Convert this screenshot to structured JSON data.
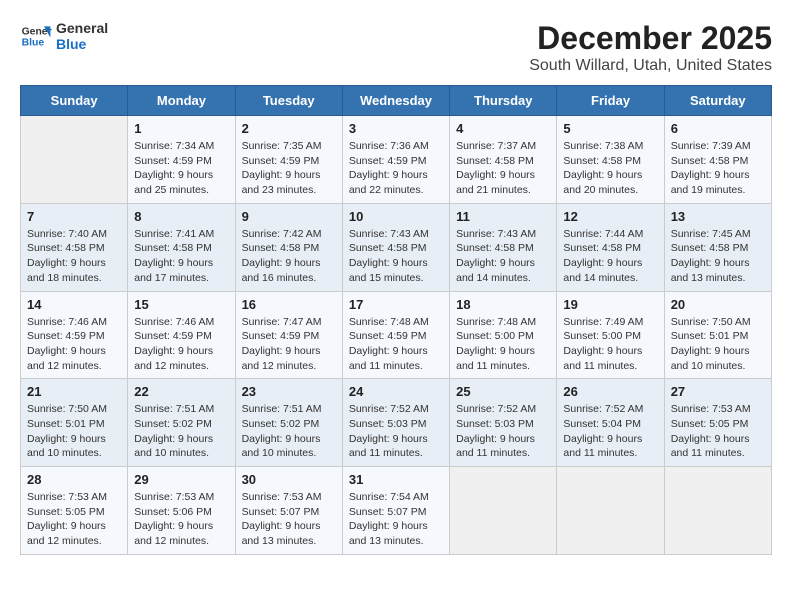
{
  "header": {
    "logo_line1": "General",
    "logo_line2": "Blue",
    "title": "December 2025",
    "subtitle": "South Willard, Utah, United States"
  },
  "calendar": {
    "days_of_week": [
      "Sunday",
      "Monday",
      "Tuesday",
      "Wednesday",
      "Thursday",
      "Friday",
      "Saturday"
    ],
    "weeks": [
      [
        {
          "day": "",
          "info": ""
        },
        {
          "day": "1",
          "info": "Sunrise: 7:34 AM\nSunset: 4:59 PM\nDaylight: 9 hours and 25 minutes."
        },
        {
          "day": "2",
          "info": "Sunrise: 7:35 AM\nSunset: 4:59 PM\nDaylight: 9 hours and 23 minutes."
        },
        {
          "day": "3",
          "info": "Sunrise: 7:36 AM\nSunset: 4:59 PM\nDaylight: 9 hours and 22 minutes."
        },
        {
          "day": "4",
          "info": "Sunrise: 7:37 AM\nSunset: 4:58 PM\nDaylight: 9 hours and 21 minutes."
        },
        {
          "day": "5",
          "info": "Sunrise: 7:38 AM\nSunset: 4:58 PM\nDaylight: 9 hours and 20 minutes."
        },
        {
          "day": "6",
          "info": "Sunrise: 7:39 AM\nSunset: 4:58 PM\nDaylight: 9 hours and 19 minutes."
        }
      ],
      [
        {
          "day": "7",
          "info": "Sunrise: 7:40 AM\nSunset: 4:58 PM\nDaylight: 9 hours and 18 minutes."
        },
        {
          "day": "8",
          "info": "Sunrise: 7:41 AM\nSunset: 4:58 PM\nDaylight: 9 hours and 17 minutes."
        },
        {
          "day": "9",
          "info": "Sunrise: 7:42 AM\nSunset: 4:58 PM\nDaylight: 9 hours and 16 minutes."
        },
        {
          "day": "10",
          "info": "Sunrise: 7:43 AM\nSunset: 4:58 PM\nDaylight: 9 hours and 15 minutes."
        },
        {
          "day": "11",
          "info": "Sunrise: 7:43 AM\nSunset: 4:58 PM\nDaylight: 9 hours and 14 minutes."
        },
        {
          "day": "12",
          "info": "Sunrise: 7:44 AM\nSunset: 4:58 PM\nDaylight: 9 hours and 14 minutes."
        },
        {
          "day": "13",
          "info": "Sunrise: 7:45 AM\nSunset: 4:58 PM\nDaylight: 9 hours and 13 minutes."
        }
      ],
      [
        {
          "day": "14",
          "info": "Sunrise: 7:46 AM\nSunset: 4:59 PM\nDaylight: 9 hours and 12 minutes."
        },
        {
          "day": "15",
          "info": "Sunrise: 7:46 AM\nSunset: 4:59 PM\nDaylight: 9 hours and 12 minutes."
        },
        {
          "day": "16",
          "info": "Sunrise: 7:47 AM\nSunset: 4:59 PM\nDaylight: 9 hours and 12 minutes."
        },
        {
          "day": "17",
          "info": "Sunrise: 7:48 AM\nSunset: 4:59 PM\nDaylight: 9 hours and 11 minutes."
        },
        {
          "day": "18",
          "info": "Sunrise: 7:48 AM\nSunset: 5:00 PM\nDaylight: 9 hours and 11 minutes."
        },
        {
          "day": "19",
          "info": "Sunrise: 7:49 AM\nSunset: 5:00 PM\nDaylight: 9 hours and 11 minutes."
        },
        {
          "day": "20",
          "info": "Sunrise: 7:50 AM\nSunset: 5:01 PM\nDaylight: 9 hours and 10 minutes."
        }
      ],
      [
        {
          "day": "21",
          "info": "Sunrise: 7:50 AM\nSunset: 5:01 PM\nDaylight: 9 hours and 10 minutes."
        },
        {
          "day": "22",
          "info": "Sunrise: 7:51 AM\nSunset: 5:02 PM\nDaylight: 9 hours and 10 minutes."
        },
        {
          "day": "23",
          "info": "Sunrise: 7:51 AM\nSunset: 5:02 PM\nDaylight: 9 hours and 10 minutes."
        },
        {
          "day": "24",
          "info": "Sunrise: 7:52 AM\nSunset: 5:03 PM\nDaylight: 9 hours and 11 minutes."
        },
        {
          "day": "25",
          "info": "Sunrise: 7:52 AM\nSunset: 5:03 PM\nDaylight: 9 hours and 11 minutes."
        },
        {
          "day": "26",
          "info": "Sunrise: 7:52 AM\nSunset: 5:04 PM\nDaylight: 9 hours and 11 minutes."
        },
        {
          "day": "27",
          "info": "Sunrise: 7:53 AM\nSunset: 5:05 PM\nDaylight: 9 hours and 11 minutes."
        }
      ],
      [
        {
          "day": "28",
          "info": "Sunrise: 7:53 AM\nSunset: 5:05 PM\nDaylight: 9 hours and 12 minutes."
        },
        {
          "day": "29",
          "info": "Sunrise: 7:53 AM\nSunset: 5:06 PM\nDaylight: 9 hours and 12 minutes."
        },
        {
          "day": "30",
          "info": "Sunrise: 7:53 AM\nSunset: 5:07 PM\nDaylight: 9 hours and 13 minutes."
        },
        {
          "day": "31",
          "info": "Sunrise: 7:54 AM\nSunset: 5:07 PM\nDaylight: 9 hours and 13 minutes."
        },
        {
          "day": "",
          "info": ""
        },
        {
          "day": "",
          "info": ""
        },
        {
          "day": "",
          "info": ""
        }
      ]
    ]
  }
}
